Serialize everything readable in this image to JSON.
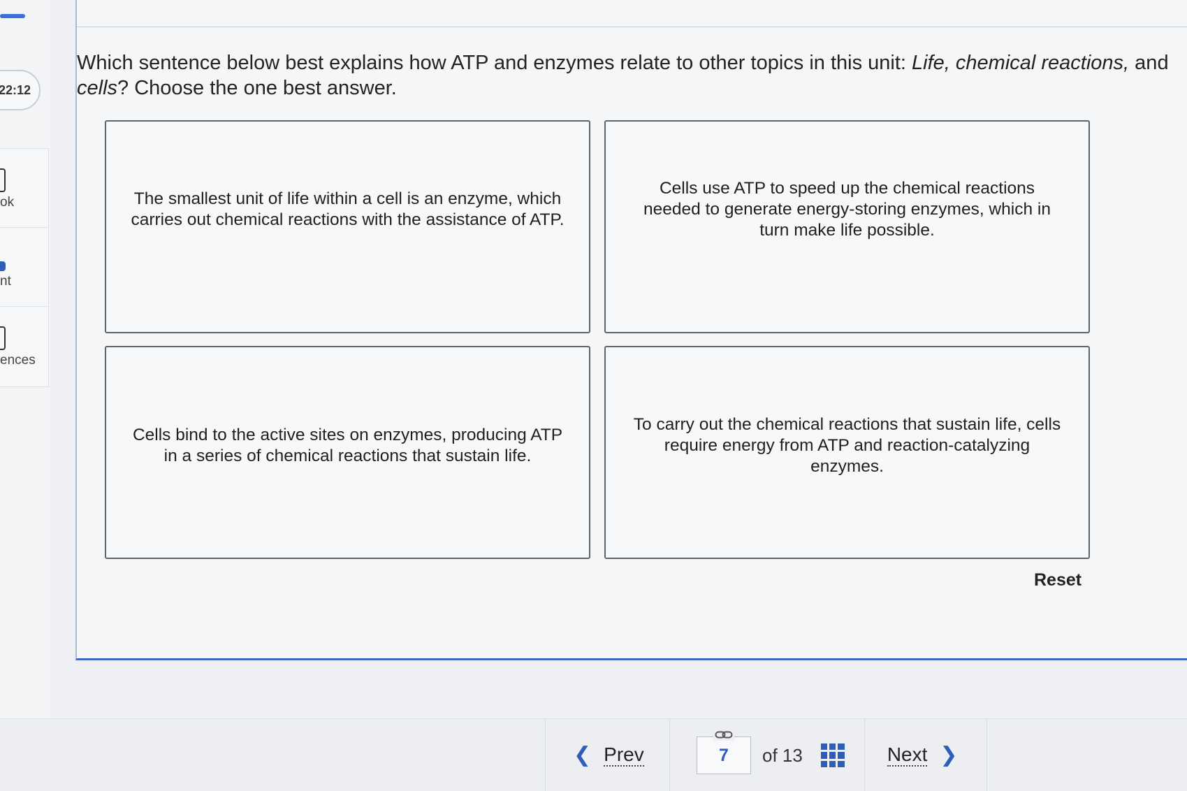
{
  "sidebar": {
    "timer": "22:12",
    "items": [
      {
        "label": "ok",
        "icon": "book-icon"
      },
      {
        "label": "nt",
        "icon": "print-icon"
      },
      {
        "label": "ences",
        "icon": "references-icon"
      }
    ]
  },
  "question": {
    "text_before": "Which sentence below best explains how ATP and enzymes relate to other topics in this unit: ",
    "text_italic_1": "Life, chemical reactions,",
    "text_middle": " and ",
    "text_italic_2": "cells",
    "text_after": "? Choose the one best answer."
  },
  "answers": [
    "The smallest unit of life within a cell is an enzyme, which carries out chemical reactions with the assistance of ATP.",
    "Cells use ATP to speed up the chemical reactions needed to generate energy-storing enzymes, which in turn make life possible.",
    "Cells bind to the active sites on enzymes, producing ATP in a series of chemical reactions that sustain life.",
    "To carry out the chemical reactions that sustain life, cells require energy from ATP and reaction-catalyzing enzymes."
  ],
  "reset_label": "Reset",
  "navigation": {
    "prev_label": "Prev",
    "current_page": "7",
    "of_total": "of 13",
    "next_label": "Next"
  },
  "colors": {
    "accent": "#2f5db8",
    "panel_border": "#3a68c4",
    "flag": "#d7262b"
  }
}
